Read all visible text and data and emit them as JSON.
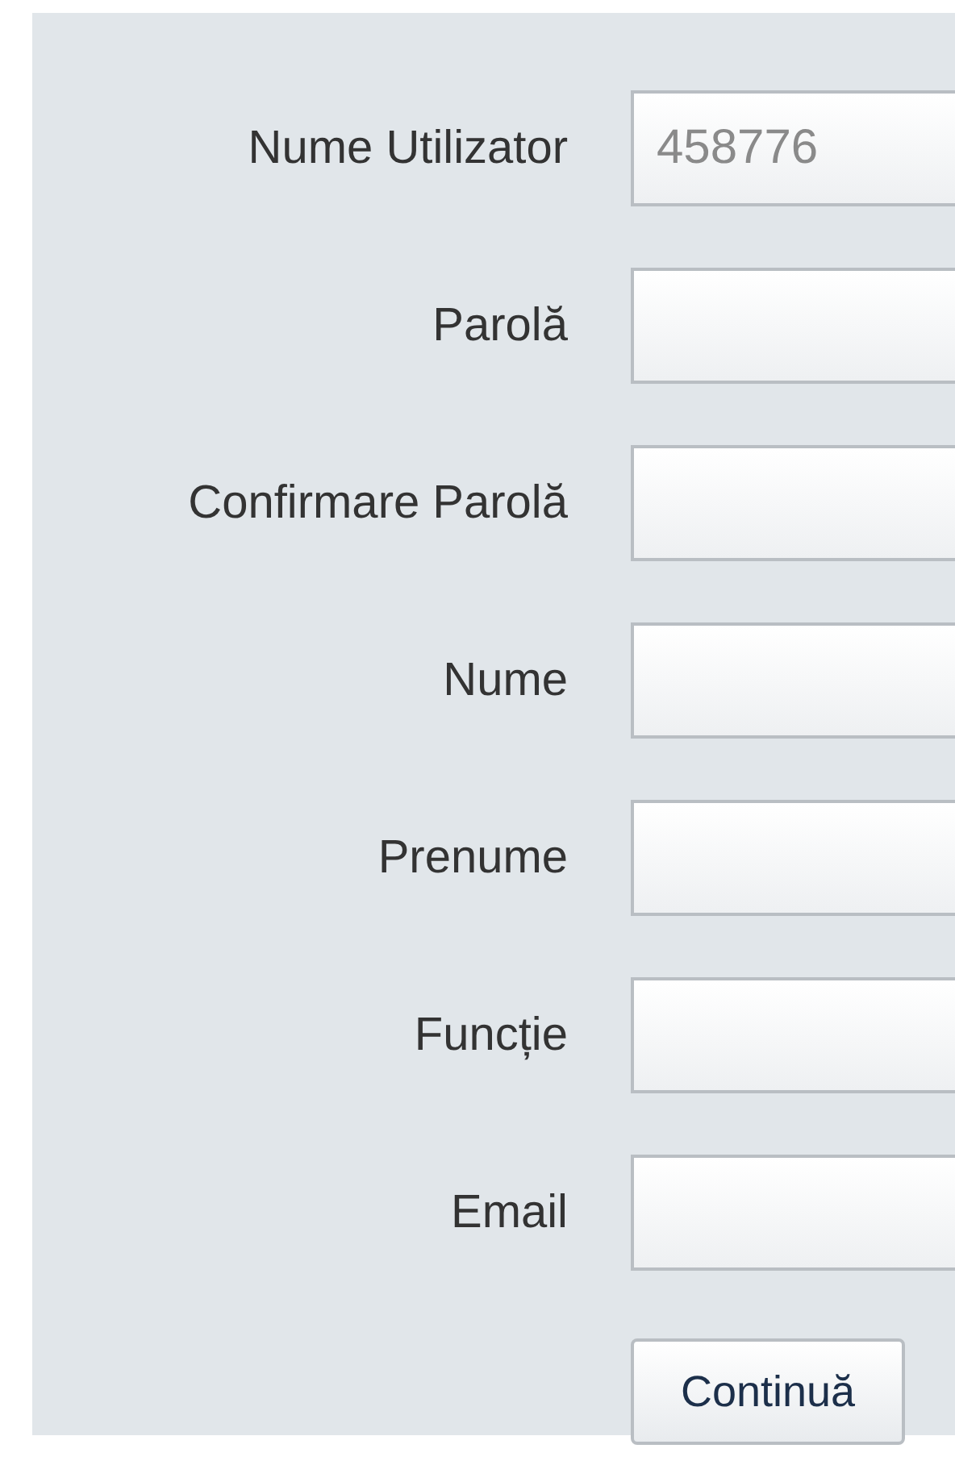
{
  "form": {
    "fields": [
      {
        "label": "Nume Utilizator",
        "placeholder": "458776"
      },
      {
        "label": "Parolă"
      },
      {
        "label": "Confirmare Parolă"
      },
      {
        "label": "Nume"
      },
      {
        "label": "Prenume"
      },
      {
        "label": "Funcție"
      },
      {
        "label": "Email"
      }
    ],
    "button": "Continuă"
  }
}
